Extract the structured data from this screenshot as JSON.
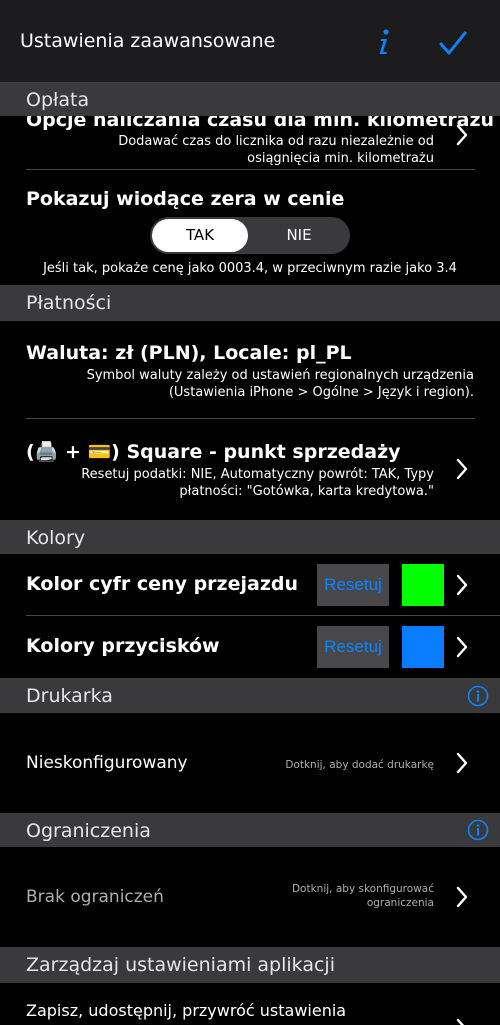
{
  "nav": {
    "title": "Ustawienia zaawansowane",
    "info_glyph": "i"
  },
  "colors": {
    "accent": "#0a84ff",
    "header_bg": "#3a3a3c",
    "fare_digits": "#00ff00",
    "buttons": "#0a7cff"
  },
  "sections": {
    "fare": "Opłata",
    "payments": "Płatności",
    "colors": "Kolory",
    "printer": "Drukarka",
    "restrictions": "Ograniczenia",
    "manage": "Zarządzaj ustawieniami aplikacji"
  },
  "fare": {
    "time_options_title": "Opcje naliczania czasu dla min. kilometrażu",
    "time_options_sub_1": "Dodawać czas do licznika od razu niezależnie od",
    "time_options_sub_2": "osiągnięcia min. kilometrażu",
    "leading_zeros_title": "Pokazuj wiodące zera w cenie",
    "yes": "TAK",
    "no": "NIE",
    "leading_zeros_sub": "Jeśli tak, pokaże cenę jako 0003.4, w przeciwnym razie jako 3.4"
  },
  "payments": {
    "currency_title": "Waluta: zł (PLN), Locale: pl_PL",
    "currency_sub_1": "Symbol waluty zależy od ustawień regionalnych urządzenia",
    "currency_sub_2": "(Ustawienia iPhone > Ogólne > Język i region).",
    "square_title": "(🖨️ + 💳) Square - punkt sprzedaży",
    "square_sub_1": "Resetuj podatki: NIE, Automatyczny powrót: TAK, Typy",
    "square_sub_2": "płatności: \"Gotówka, karta kredytowa.\""
  },
  "color_rows": {
    "fare_digits": "Kolor cyfr ceny przejazdu",
    "buttons": "Kolory przycisków",
    "reset": "Resetuj"
  },
  "printer": {
    "status": "Nieskonfigurowany",
    "hint": "Dotknij, aby dodać drukarkę"
  },
  "restrictions": {
    "status": "Brak ograniczeń",
    "hint_1": "Dotknij, aby skonfigurować",
    "hint_2": "ograniczenia"
  },
  "manage": {
    "title": "Zapisz, udostępnij, przywróć ustawienia"
  }
}
